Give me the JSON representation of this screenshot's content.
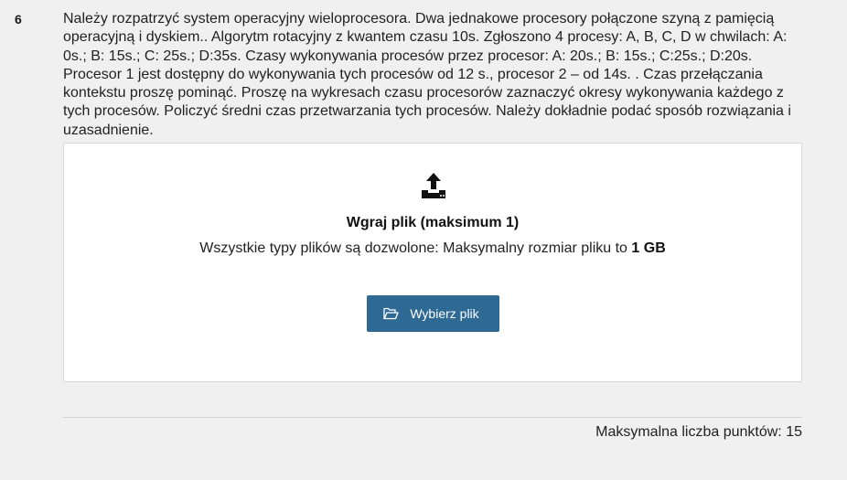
{
  "question": {
    "number": "6",
    "text": "Należy rozpatrzyć system operacyjny wieloprocesora. Dwa jednakowe procesory połączone szyną z pamięcią operacyjną i dyskiem.. Algorytm rotacyjny z kwantem czasu 10s. Zgłoszono 4 procesy: A, B, C, D w chwilach: A: 0s.; B: 15s.; C: 25s.; D:35s. Czasy wykonywania procesów przez procesor: A: 20s.; B: 15s.; C:25s.; D:20s. Procesor 1 jest dostępny do wykonywania tych procesów od 12 s., procesor 2 – od 14s. . Czas przełączania kontekstu proszę pominąć. Proszę na wykresach czasu procesorów zaznaczyć okresy wykonywania każdego z tych procesów. Policzyć średni czas przetwarzania tych procesów. Należy dokładnie podać sposób rozwiązania i uzasadnienie."
  },
  "upload": {
    "icon": "upload-icon",
    "title": "Wgraj plik (maksimum 1)",
    "hint_prefix": "Wszystkie typy plików są dozwolone: Maksymalny rozmiar pliku to ",
    "hint_size": "1 GB",
    "button_label": "Wybierz plik",
    "button_icon": "folder-open-icon",
    "button_color": "#2f6a94"
  },
  "footer": {
    "max_points": "Maksymalna liczba punktów: 15"
  }
}
